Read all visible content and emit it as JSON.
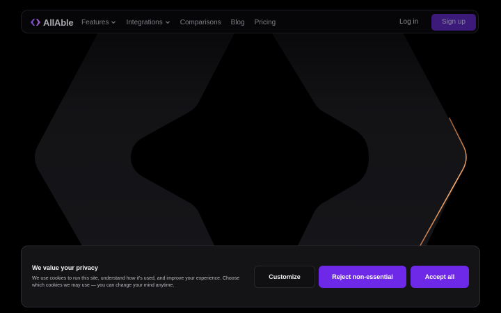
{
  "brand": {
    "name": "AllAble",
    "logo_icon": "allable-logo-mark",
    "accent_color": "#6d28e8"
  },
  "nav": {
    "items": [
      {
        "label": "Features",
        "has_dropdown": true
      },
      {
        "label": "Integrations",
        "has_dropdown": true
      },
      {
        "label": "Comparisons",
        "has_dropdown": false
      },
      {
        "label": "Blog",
        "has_dropdown": false
      },
      {
        "label": "Pricing",
        "has_dropdown": false
      }
    ],
    "login_label": "Log in",
    "signup_label": "Sign up"
  },
  "cookie_banner": {
    "title": "We value your privacy",
    "body": "We use cookies to run this site, understand how it's used, and improve your experience. Choose which cookies we may use — you can change your mind anytime.",
    "customize_label": "Customize",
    "reject_label": "Reject non-essential",
    "accept_label": "Accept all"
  }
}
